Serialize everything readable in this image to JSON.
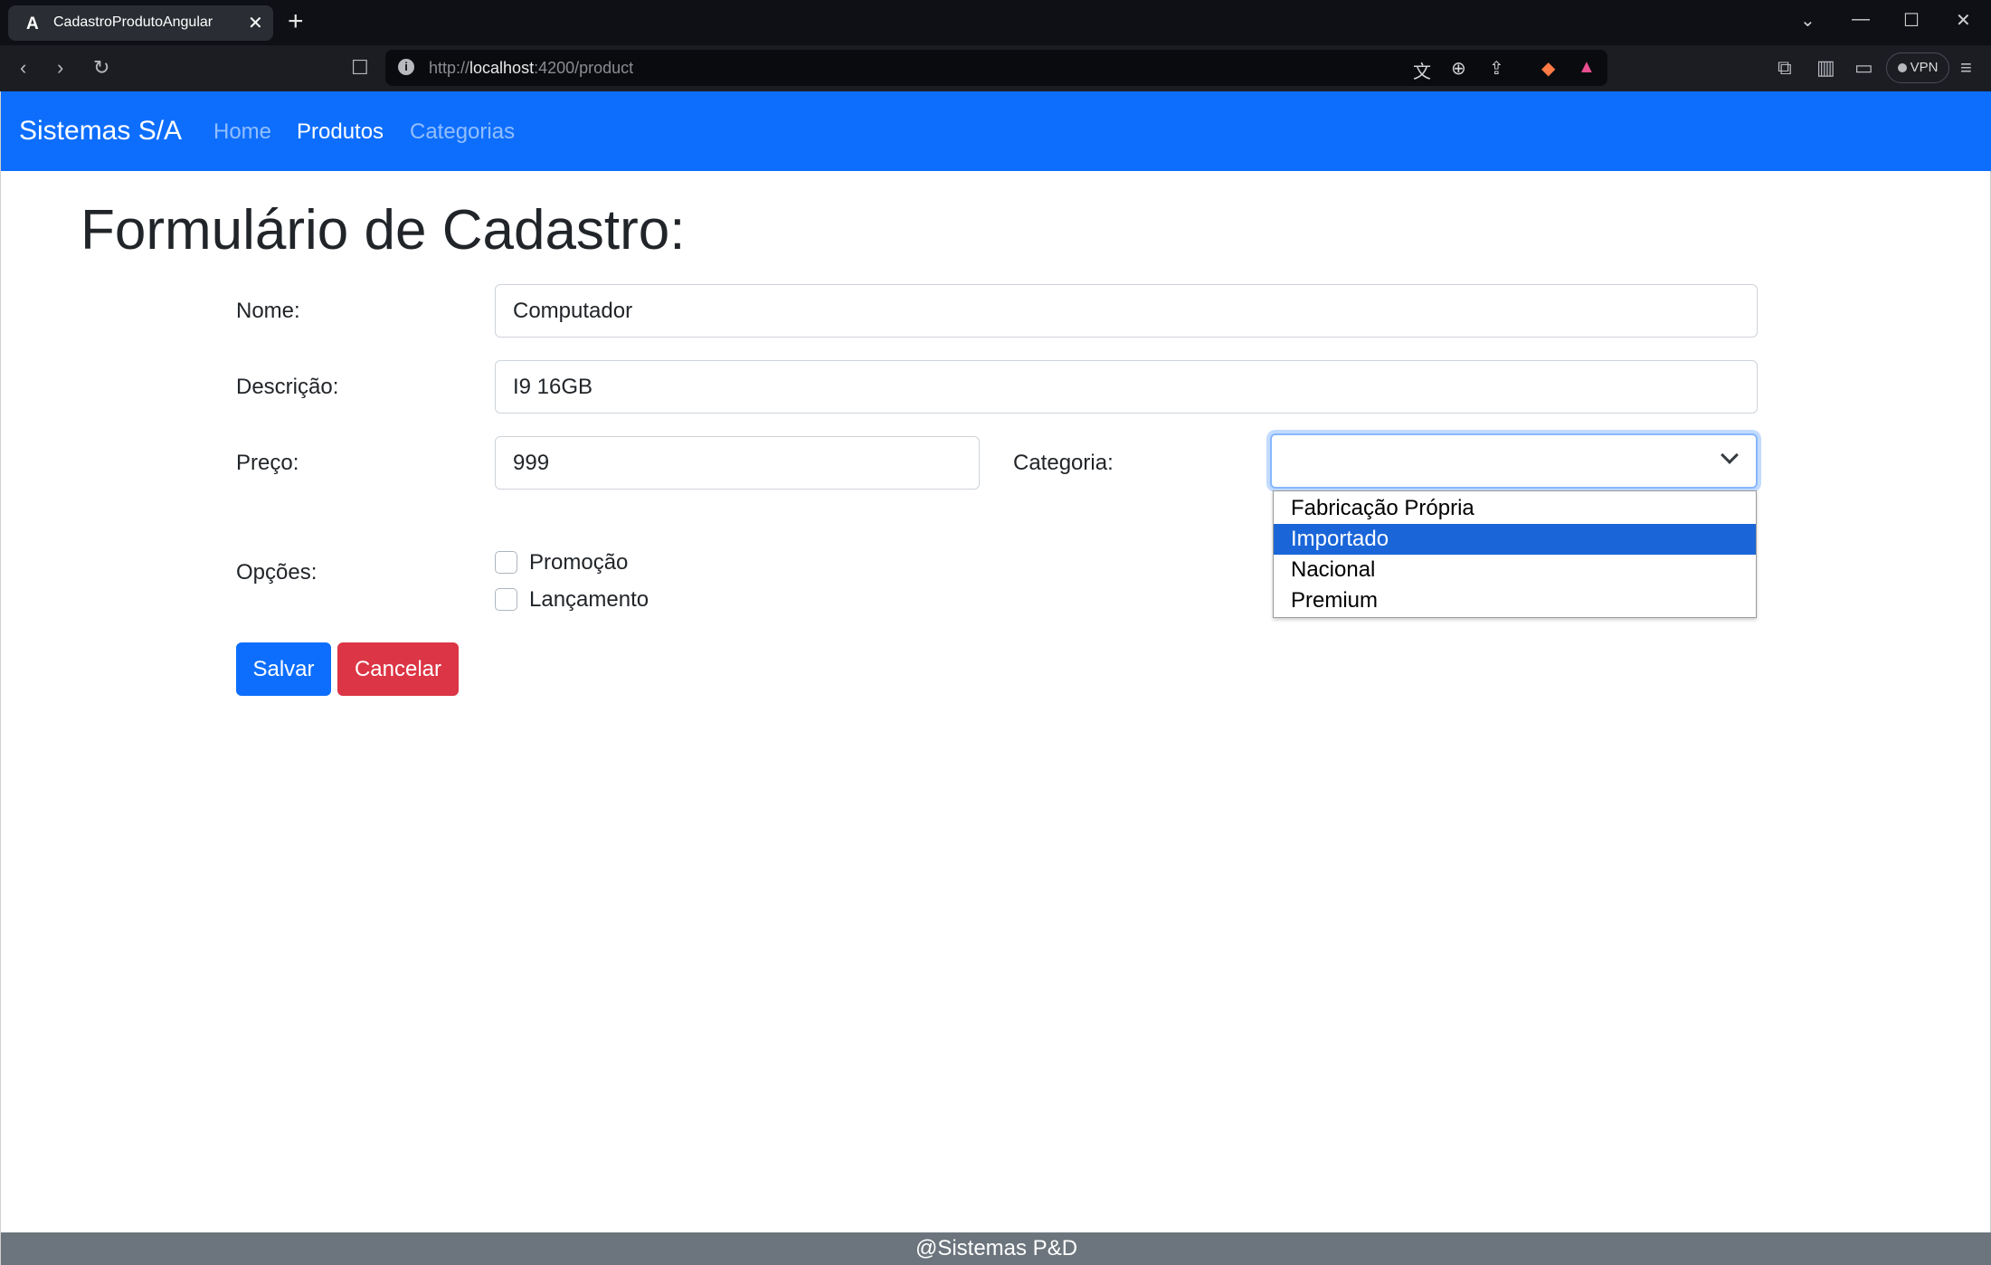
{
  "browser": {
    "tab_title": "CadastroProdutoAngular",
    "tab_favicon": "A",
    "url_prefix": "http://",
    "url_host": "localhost",
    "url_path": ":4200/product",
    "vpn_label": "VPN"
  },
  "navbar": {
    "brand": "Sistemas S/A",
    "links": [
      {
        "label": "Home",
        "state": "inactive"
      },
      {
        "label": "Produtos",
        "state": "active"
      },
      {
        "label": "Categorias",
        "state": "inactive"
      }
    ]
  },
  "form": {
    "title": "Formulário de Cadastro:",
    "nome": {
      "label": "Nome:",
      "value": "Computador"
    },
    "descricao": {
      "label": "Descrição:",
      "value": "I9 16GB"
    },
    "preco": {
      "label": "Preço:",
      "value": "999"
    },
    "categoria": {
      "label": "Categoria:",
      "selected": "",
      "options": [
        "Fabricação Própria",
        "Importado",
        "Nacional",
        "Premium"
      ],
      "highlighted_option": "Importado"
    },
    "opcoes": {
      "label": "Opções:",
      "items": [
        {
          "label": "Promoção",
          "checked": false
        },
        {
          "label": "Lançamento",
          "checked": false
        }
      ]
    },
    "save_label": "Salvar",
    "cancel_label": "Cancelar"
  },
  "footer": {
    "text": "@Sistemas P&D"
  },
  "colors": {
    "primary": "#0d6efd",
    "danger": "#dc3545",
    "footer": "#6c757d",
    "dropdown_highlight": "#1a66d9"
  }
}
